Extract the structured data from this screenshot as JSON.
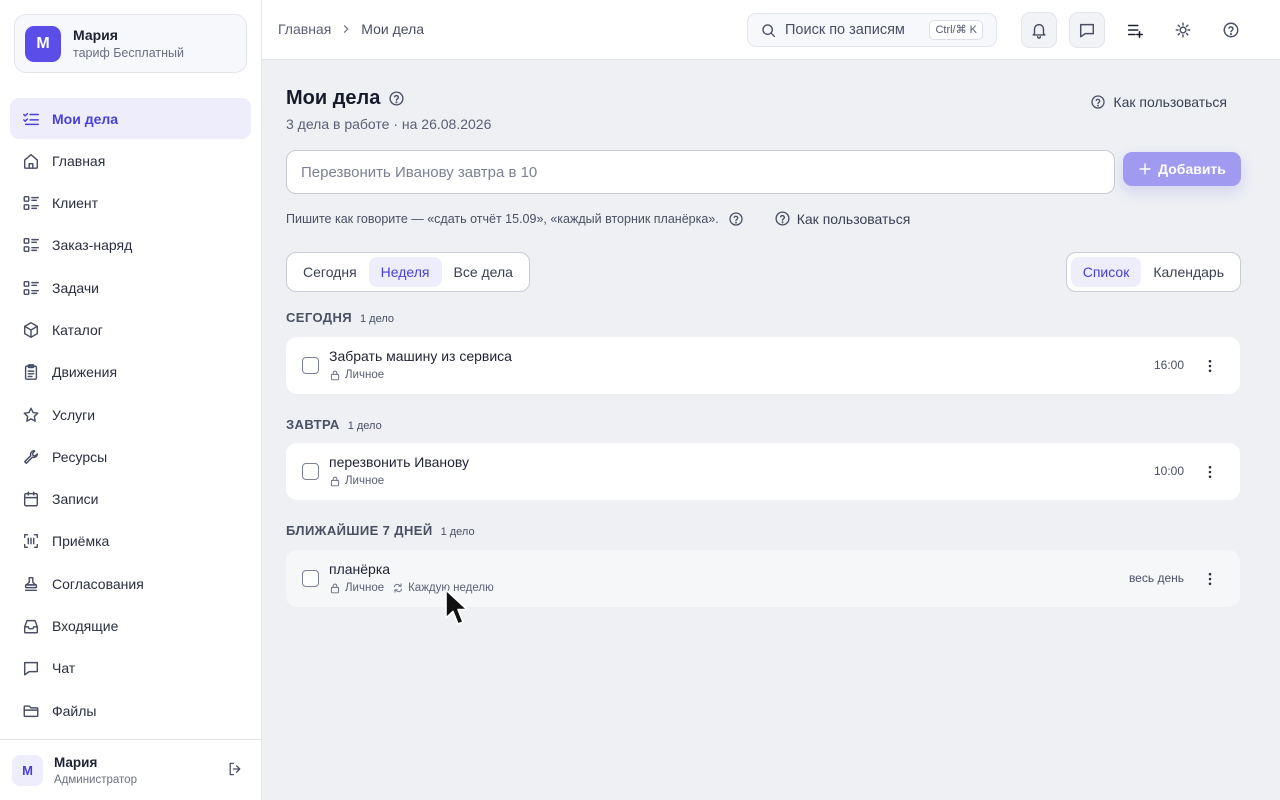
{
  "org": {
    "avatar": "М",
    "name": "Мария",
    "plan": "тариф Бесплатный"
  },
  "sidebar": {
    "items": [
      {
        "label": "Мои дела",
        "icon": "checklist-icon",
        "active": true
      },
      {
        "label": "Главная",
        "icon": "home-icon"
      },
      {
        "label": "Клиент",
        "icon": "list-icon"
      },
      {
        "label": "Заказ-наряд",
        "icon": "list-icon"
      },
      {
        "label": "Задачи",
        "icon": "list-icon"
      },
      {
        "label": "Каталог",
        "icon": "cube-icon"
      },
      {
        "label": "Движения",
        "icon": "clipboard-icon"
      },
      {
        "label": "Услуги",
        "icon": "star-icon"
      },
      {
        "label": "Ресурсы",
        "icon": "wrench-icon"
      },
      {
        "label": "Записи",
        "icon": "calendar-icon"
      },
      {
        "label": "Приёмка",
        "icon": "scan-icon"
      },
      {
        "label": "Согласования",
        "icon": "stamp-icon"
      },
      {
        "label": "Входящие",
        "icon": "inbox-icon"
      },
      {
        "label": "Чат",
        "icon": "chat-icon"
      },
      {
        "label": "Файлы",
        "icon": "folder-icon"
      }
    ]
  },
  "user": {
    "avatar": "М",
    "name": "Мария",
    "role": "Администратор"
  },
  "topbar": {
    "breadcrumb_home": "Главная",
    "breadcrumb_current": "Мои дела",
    "search_placeholder": "Поиск по записям",
    "search_shortcut": "Ctrl/⌘ K"
  },
  "page": {
    "title": "Мои дела",
    "subtitle": "3 дела в работе · на 26.08.2026",
    "howto": "Как пользоваться",
    "input_placeholder": "Перезвонить Иванову завтра в 10",
    "add_label": "Добавить",
    "hint": "Пишите как говорите — «сдать отчёт 15.09», «каждый вторник планёрка».",
    "howto_inline": "Как пользоваться"
  },
  "filters": {
    "today": "Сегодня",
    "week": "Неделя",
    "all": "Все дела",
    "active": "week"
  },
  "views": {
    "list": "Список",
    "calendar": "Календарь",
    "active": "list"
  },
  "groups": [
    {
      "title": "СЕГОДНЯ",
      "count": "1 дело",
      "tasks": [
        {
          "title": "Забрать машину из сервиса",
          "tag": "Личное",
          "time": "16:00"
        }
      ]
    },
    {
      "title": "ЗАВТРА",
      "count": "1 дело",
      "tasks": [
        {
          "title": "перезвонить Иванову",
          "tag": "Личное",
          "time": "10:00"
        }
      ]
    },
    {
      "title": "БЛИЖАЙШИЕ 7 ДНЕЙ",
      "count": "1 дело",
      "tasks": [
        {
          "title": "планёрка",
          "tag": "Личное",
          "repeat": "Каждую неделю",
          "time": "весь день"
        }
      ]
    }
  ],
  "colors": {
    "accent": "#4a3fd9",
    "accent_soft": "#eeedfb",
    "add_button": "#a09af0",
    "org_avatar": "#5b4ee8"
  }
}
